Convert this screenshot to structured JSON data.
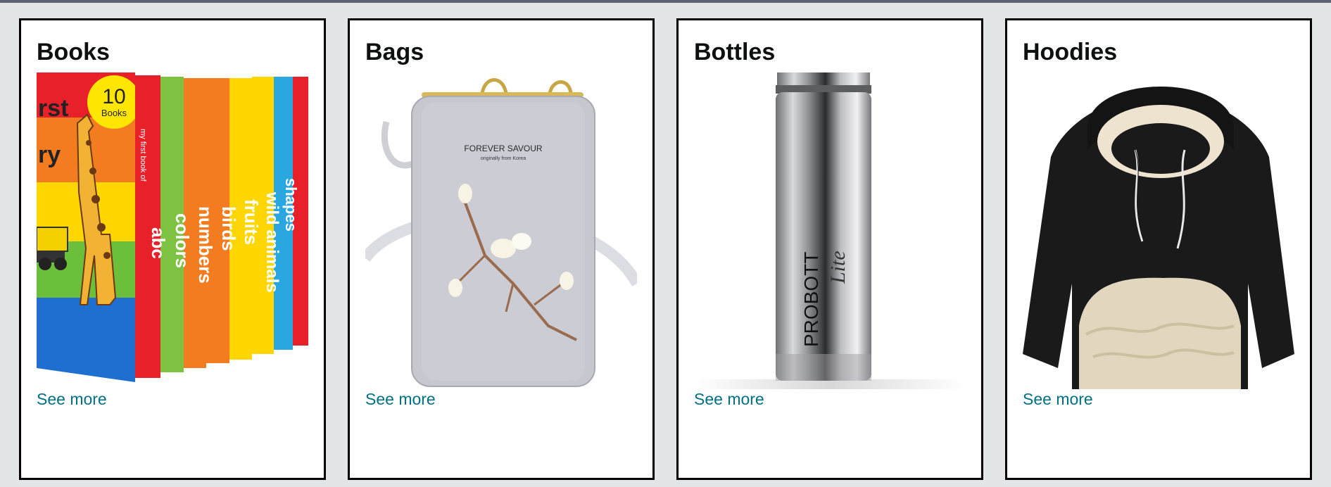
{
  "colors": {
    "page_background": "#e3e6e6",
    "top_strip": "#5f6273",
    "card_border": "#000000",
    "title": "#0f1111",
    "link": "#007185"
  },
  "cards": [
    {
      "title": "Books",
      "image_icon": "children-board-books-box-set",
      "image_text": {
        "badge_number": "10",
        "badge_word": "Books",
        "spines": [
          "abc",
          "colors",
          "numbers",
          "birds",
          "fruits",
          "wild animals",
          "shapes"
        ],
        "spine_series": "my first book of"
      },
      "link_label": "See more"
    },
    {
      "title": "Bags",
      "image_icon": "grey-crossbody-phone-bag",
      "image_text": {
        "brand": "FOREVER SAVOUR",
        "tagline": "originally from Korea"
      },
      "link_label": "See more"
    },
    {
      "title": "Bottles",
      "image_icon": "steel-water-bottle",
      "image_text": {
        "brand": "PROBOTT",
        "script": "Lite"
      },
      "link_label": "See more"
    },
    {
      "title": "Hoodies",
      "image_icon": "black-fleece-hoodie",
      "link_label": "See more"
    }
  ]
}
